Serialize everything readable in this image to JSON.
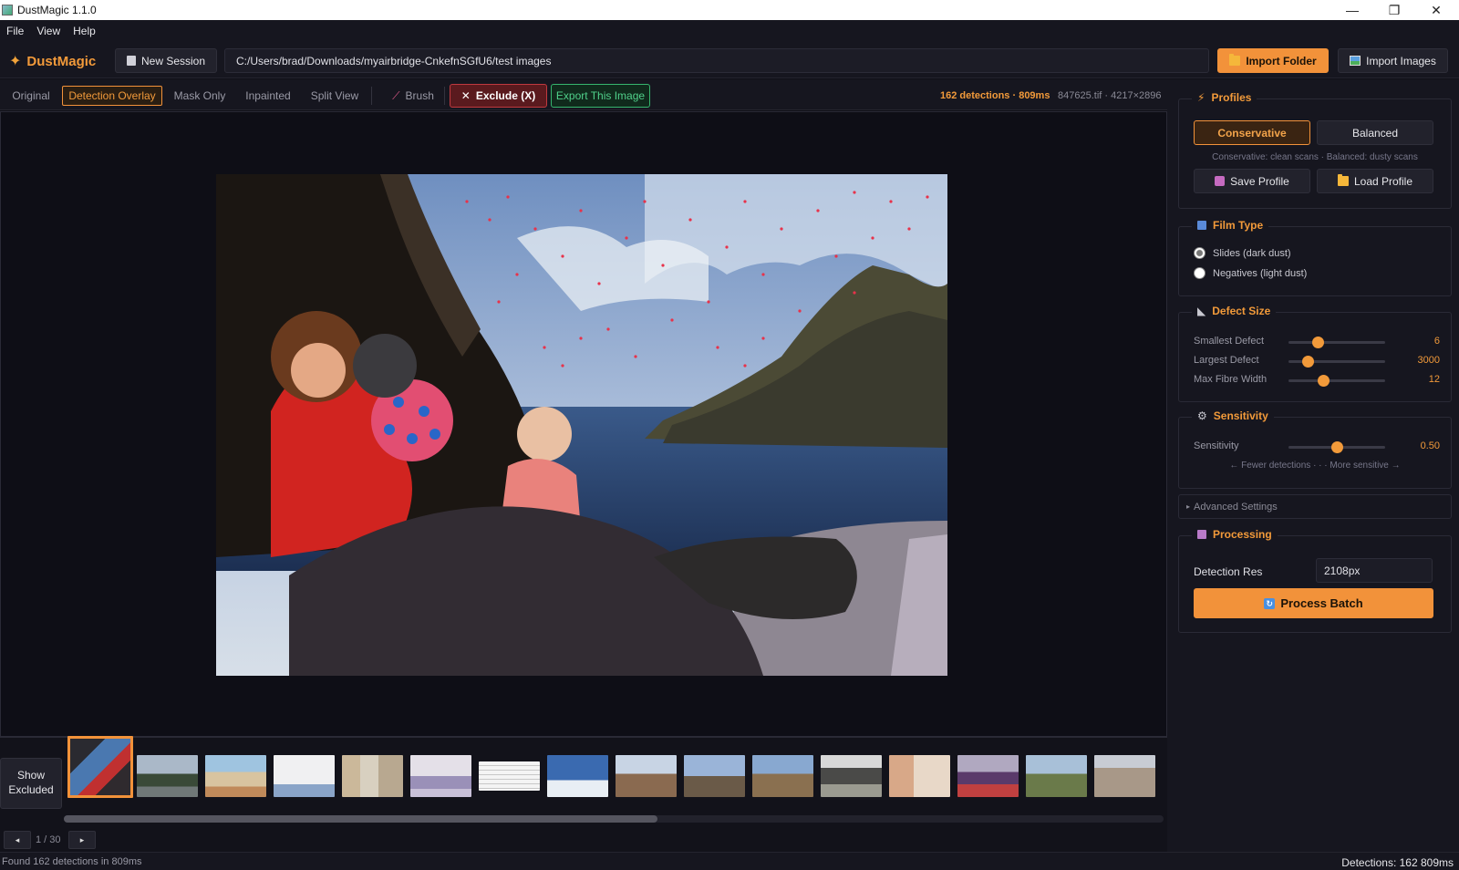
{
  "window": {
    "title": "DustMagic 1.1.0",
    "minimize": "—",
    "maximize": "❐",
    "close": "✕"
  },
  "menu": [
    "File",
    "View",
    "Help"
  ],
  "toolbar": {
    "brand": "DustMagic",
    "new_session": "New Session",
    "path": "C:/Users/brad/Downloads/myairbridge-CnkefnSGfU6/test images",
    "import_folder": "Import Folder",
    "import_images": "Import Images"
  },
  "viewbar": {
    "tabs": [
      "Original",
      "Detection Overlay",
      "Mask Only",
      "Inpainted",
      "Split View"
    ],
    "active_tab": "Detection Overlay",
    "brush": "Brush",
    "exclude": "Exclude (X)",
    "export": "Export This Image",
    "detection_stats": "162 detections · 809ms",
    "file_meta": "847625.tif · 4217×2896"
  },
  "panel": {
    "profiles": {
      "title": "Profiles",
      "conservative": "Conservative",
      "balanced": "Balanced",
      "hint": "Conservative: clean scans · Balanced: dusty scans",
      "save": "Save Profile",
      "load": "Load Profile"
    },
    "film_type": {
      "title": "Film Type",
      "options": [
        "Slides (dark dust)",
        "Negatives (light dust)"
      ],
      "selected": 0
    },
    "defect_size": {
      "title": "Defect Size",
      "sliders": [
        {
          "label": "Smallest Defect",
          "value": "6",
          "level": 0.3
        },
        {
          "label": "Largest Defect",
          "value": "3000",
          "level": 0.2
        },
        {
          "label": "Max Fibre Width",
          "value": "12",
          "level": 0.36
        }
      ]
    },
    "sensitivity": {
      "title": "Sensitivity",
      "label": "Sensitivity",
      "value": "0.50",
      "level": 0.5,
      "hint": "← Fewer detections · · · More sensitive →"
    },
    "advanced": "Advanced Settings",
    "processing": {
      "title": "Processing",
      "res_label": "Detection Res",
      "res_value": "2108px",
      "process": "Process Batch"
    }
  },
  "filmstrip": {
    "show_excluded_1": "Show",
    "show_excluded_2": "Excluded",
    "page": "1 / 30",
    "prev": "◂",
    "next": "▸",
    "scroll_fraction": 0.54
  },
  "status": {
    "left": "Found 162 detections in 809ms",
    "right": "Detections: 162  809ms"
  },
  "colors": {
    "accent": "#f2923a",
    "danger": "#c0393f",
    "success": "#36b56e"
  }
}
